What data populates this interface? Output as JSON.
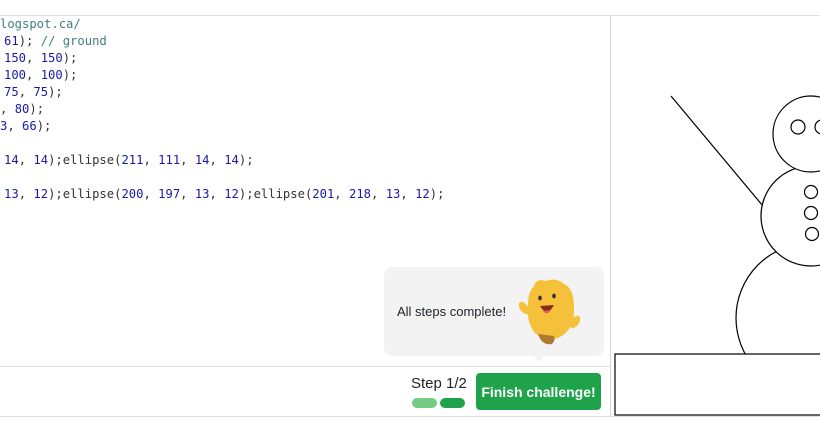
{
  "editor": {
    "lines": [
      [
        {
          "t": "logspot.ca/",
          "c": "comment"
        }
      ],
      [
        {
          "t": "61",
          "c": "num"
        },
        {
          "t": "); ",
          "c": "plain"
        },
        {
          "t": "// ground",
          "c": "comment"
        }
      ],
      [
        {
          "t": "150",
          "c": "num"
        },
        {
          "t": ", ",
          "c": "plain"
        },
        {
          "t": "150",
          "c": "num"
        },
        {
          "t": ");",
          "c": "plain"
        }
      ],
      [
        {
          "t": "100",
          "c": "num"
        },
        {
          "t": ", ",
          "c": "plain"
        },
        {
          "t": "100",
          "c": "num"
        },
        {
          "t": ");",
          "c": "plain"
        }
      ],
      [
        {
          "t": "75",
          "c": "num"
        },
        {
          "t": ", ",
          "c": "plain"
        },
        {
          "t": "75",
          "c": "num"
        },
        {
          "t": ");",
          "c": "plain"
        }
      ],
      [
        {
          "t": ", ",
          "c": "plain"
        },
        {
          "t": "80",
          "c": "num"
        },
        {
          "t": ");",
          "c": "plain"
        }
      ],
      [
        {
          "t": "3",
          "c": "num"
        },
        {
          "t": ", ",
          "c": "plain"
        },
        {
          "t": "66",
          "c": "num"
        },
        {
          "t": ");",
          "c": "plain"
        }
      ],
      [],
      [
        {
          "t": "14",
          "c": "num"
        },
        {
          "t": ", ",
          "c": "plain"
        },
        {
          "t": "14",
          "c": "num"
        },
        {
          "t": ");ellipse(",
          "c": "plain"
        },
        {
          "t": "211",
          "c": "num"
        },
        {
          "t": ", ",
          "c": "plain"
        },
        {
          "t": "111",
          "c": "num"
        },
        {
          "t": ", ",
          "c": "plain"
        },
        {
          "t": "14",
          "c": "num"
        },
        {
          "t": ", ",
          "c": "plain"
        },
        {
          "t": "14",
          "c": "num"
        },
        {
          "t": ");",
          "c": "plain"
        }
      ],
      [],
      [
        {
          "t": "13",
          "c": "num"
        },
        {
          "t": ", ",
          "c": "plain"
        },
        {
          "t": "12",
          "c": "num"
        },
        {
          "t": ");ellipse(",
          "c": "plain"
        },
        {
          "t": "200",
          "c": "num"
        },
        {
          "t": ", ",
          "c": "plain"
        },
        {
          "t": "197",
          "c": "num"
        },
        {
          "t": ", ",
          "c": "plain"
        },
        {
          "t": "13",
          "c": "num"
        },
        {
          "t": ", ",
          "c": "plain"
        },
        {
          "t": "12",
          "c": "num"
        },
        {
          "t": ");ellipse(",
          "c": "plain"
        },
        {
          "t": "201",
          "c": "num"
        },
        {
          "t": ", ",
          "c": "plain"
        },
        {
          "t": "218",
          "c": "num"
        },
        {
          "t": ", ",
          "c": "plain"
        },
        {
          "t": "13",
          "c": "num"
        },
        {
          "t": ", ",
          "c": "plain"
        },
        {
          "t": "12",
          "c": "num"
        },
        {
          "t": ");",
          "c": "plain"
        }
      ]
    ]
  },
  "message": {
    "text": "All steps complete!",
    "mascot_icon": "winston-mascot-icon"
  },
  "footer": {
    "step_label": "Step 1/2",
    "progress": {
      "total_steps": 2,
      "completed_steps": 2
    },
    "finish_label": "Finish challenge!"
  },
  "colors": {
    "accent_green": "#1fa34a",
    "progress_light": "#76cc82",
    "progress_dark": "#1fa34a",
    "code_comment": "#408080",
    "code_number": "#1a1aa6",
    "code_plain": "#333333",
    "mascot_yellow": "#f5c13a"
  }
}
